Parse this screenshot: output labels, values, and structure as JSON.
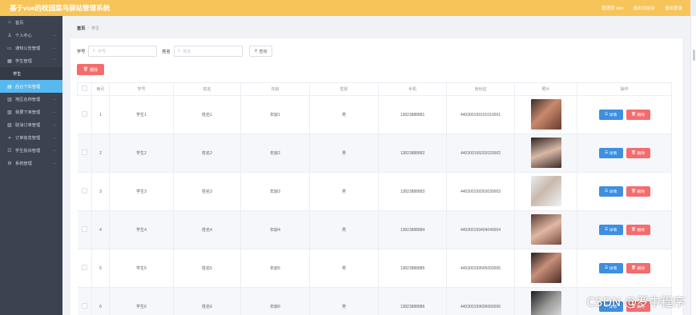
{
  "app": {
    "title": "基于vue的校园菜鸟驿站管理系统",
    "header_actions": [
      "管理员 abo",
      "退出到前台",
      "退出登录"
    ]
  },
  "sidebar": {
    "items": [
      {
        "label": "首页",
        "icon": "home-icon",
        "chevron": false
      },
      {
        "label": "个人中心",
        "icon": "user-icon",
        "chevron": true
      },
      {
        "label": "通知公告管理",
        "icon": "notice-icon",
        "chevron": true
      },
      {
        "label": "学生管理",
        "icon": "student-icon",
        "chevron": true
      },
      {
        "label": "学生",
        "icon": "",
        "chevron": false,
        "sub": true
      },
      {
        "label": "后台下单管理",
        "icon": "order-icon",
        "chevron": false,
        "hover": true
      },
      {
        "label": "地区名称管理",
        "icon": "region-icon",
        "chevron": true
      },
      {
        "label": "我要下单管理",
        "icon": "place-order-icon",
        "chevron": true
      },
      {
        "label": "取消订单管理",
        "icon": "cancel-order-icon",
        "chevron": true
      },
      {
        "label": "订单信息管理",
        "icon": "send-icon",
        "chevron": true
      },
      {
        "label": "学生投诉管理",
        "icon": "complaint-icon",
        "chevron": true
      },
      {
        "label": "系统管理",
        "icon": "settings-icon",
        "chevron": true
      }
    ]
  },
  "breadcrumb": {
    "home": "首页",
    "current": "学生"
  },
  "search": {
    "student_no_label": "学号",
    "student_no_placeholder": "学号",
    "name_label": "姓名",
    "name_placeholder": "姓名",
    "query_button": "查询"
  },
  "toolbar": {
    "delete_button": "删除"
  },
  "table": {
    "columns": [
      "索引",
      "学号",
      "姓名",
      "年龄",
      "性别",
      "手机",
      "身份证",
      "照片",
      "操作"
    ],
    "detail_label": "详情",
    "delete_label": "删除",
    "rows": [
      {
        "index": "1",
        "student_no": "学生1",
        "name": "姓名1",
        "age": "年龄1",
        "gender": "男",
        "phone": "13823888881",
        "id_card": "440300199101010001"
      },
      {
        "index": "2",
        "student_no": "学生2",
        "name": "姓名2",
        "age": "年龄2",
        "gender": "男",
        "phone": "13823888882",
        "id_card": "440300199202020002"
      },
      {
        "index": "3",
        "student_no": "学生3",
        "name": "姓名3",
        "age": "年龄3",
        "gender": "男",
        "phone": "13823888883",
        "id_card": "440300199303030003"
      },
      {
        "index": "4",
        "student_no": "学生4",
        "name": "姓名4",
        "age": "年龄4",
        "gender": "男",
        "phone": "13823888884",
        "id_card": "440300199404040004"
      },
      {
        "index": "5",
        "student_no": "学生5",
        "name": "姓名5",
        "age": "年龄5",
        "gender": "男",
        "phone": "13823888885",
        "id_card": "440300199505050005"
      },
      {
        "index": "6",
        "student_no": "学生6",
        "name": "姓名6",
        "age": "年龄6",
        "gender": "男",
        "phone": "13823888886",
        "id_card": "440300199606060006"
      }
    ]
  },
  "watermark": "CSDN @罗中程序",
  "colors": {
    "header": "#f7c45a",
    "sidebar": "#3b4250",
    "hover": "#58b9f0",
    "primary": "#3d8fe0",
    "danger": "#f56c6c"
  }
}
